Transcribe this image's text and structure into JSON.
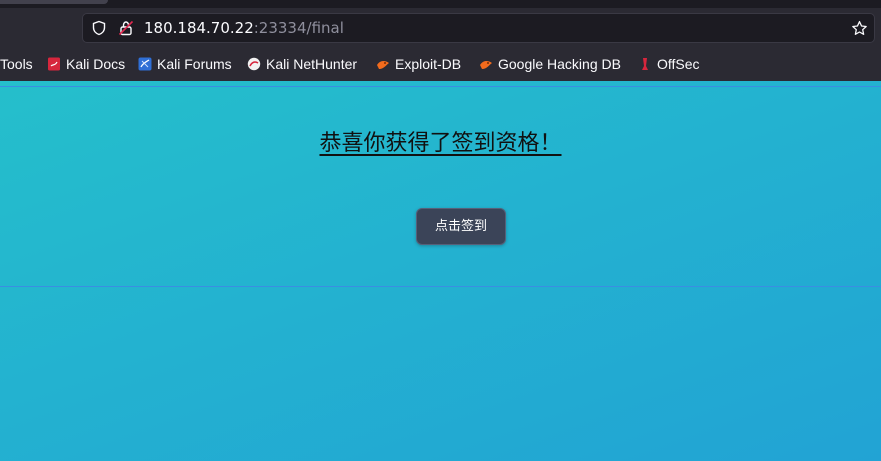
{
  "browser": {
    "url_host": "180.184.70.22",
    "url_rest": ":23334/final"
  },
  "bookmarks": [
    {
      "label": "Tools",
      "icon": "none"
    },
    {
      "label": "Kali Docs",
      "icon": "kali-docs-icon"
    },
    {
      "label": "Kali Forums",
      "icon": "kali-forums-icon"
    },
    {
      "label": "Kali NetHunter",
      "icon": "kali-nethunter-icon"
    },
    {
      "label": "Exploit-DB",
      "icon": "exploit-db-icon"
    },
    {
      "label": "Google Hacking DB",
      "icon": "google-hacking-db-icon"
    },
    {
      "label": "OffSec",
      "icon": "offsec-icon"
    }
  ],
  "page": {
    "headline": "恭喜你获得了签到资格！",
    "button_label": "点击签到",
    "background_color": "#23b2d0",
    "button_color": "#3b4458"
  }
}
